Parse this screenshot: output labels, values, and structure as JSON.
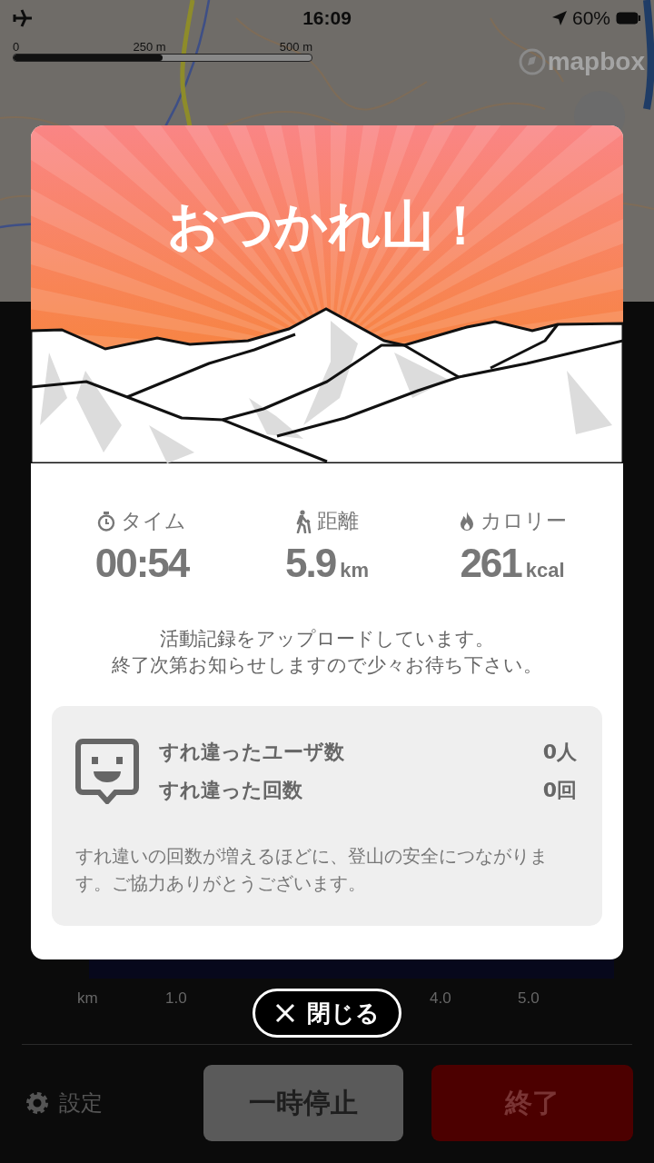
{
  "status_bar": {
    "time": "16:09",
    "battery": "60%"
  },
  "map": {
    "scale_labels": [
      "0",
      "250 m",
      "500 m"
    ],
    "attribution": "mapbox"
  },
  "chart": {
    "axis_labels": [
      "km",
      "1.0",
      "4.0",
      "5.0"
    ]
  },
  "bottom_bar": {
    "settings": "設定",
    "pause_button": "一時停止",
    "finish_button": "終了"
  },
  "result": {
    "title": "おつかれ山！",
    "stats": [
      {
        "kind": "time",
        "label": "タイム",
        "value": "00:54"
      },
      {
        "kind": "distance",
        "label": "距離",
        "value": "5.9",
        "unit": "km"
      },
      {
        "kind": "calories",
        "label": "カロリー",
        "value": "261",
        "unit": "kcal"
      }
    ],
    "message_lines": [
      "活動記録をアップロードしています。",
      "終了次第お知らせしますので少々お待ち下さい。"
    ],
    "encounters": {
      "rows": [
        {
          "label": "すれ違ったユーザ数",
          "value": "0人"
        },
        {
          "label": "すれ違った回数",
          "value": "0回"
        }
      ],
      "note": "すれ違いの回数が増えるほどに、登山の安全につながります。ご協力ありがとうございます。"
    }
  },
  "close_button": "閉じる"
}
